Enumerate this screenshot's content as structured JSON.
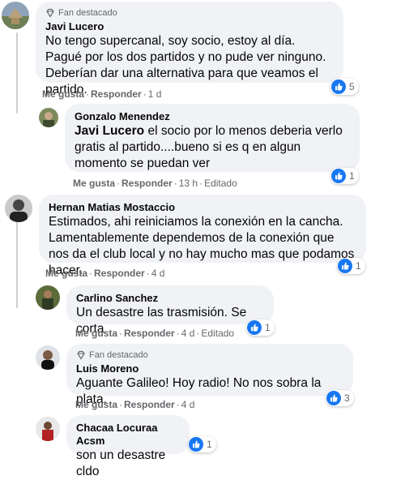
{
  "comments": [
    {
      "badge": "Fan destacado",
      "name": "Javi Lucero",
      "text": "No tengo supercanal, soy socio, estoy al día. Pagué por los dos partidos y no pude ver ninguno. Deberían dar una alternativa para que veamos el partido.",
      "like": "Me gusta",
      "reply": "Responder",
      "time": "1 d",
      "reactions": "5"
    },
    {
      "name": "Gonzalo Menendez",
      "tag": "Javi Lucero",
      "text": " el socio por lo menos deberia verlo gratis al partido....bueno si es q en algun momento se puedan ver",
      "like": "Me gusta",
      "reply": "Responder",
      "time": "13 h",
      "edited": "Editado",
      "reactions": "1"
    },
    {
      "name": "Hernan Matias Mostaccio",
      "text": "Estimados, ahi reiniciamos la conexión en la cancha. Lamentablemente dependemos de la conexión que nos da el club local y no hay mucho mas que podamos hacer.",
      "like": "Me gusta",
      "reply": "Responder",
      "time": "4 d",
      "reactions": "1"
    },
    {
      "name": "Carlino Sanchez",
      "text": "Un desastre las trasmisión. Se corta",
      "like": "Me gusta",
      "reply": "Responder",
      "time": "4 d",
      "edited": "Editado",
      "reactions": "1"
    },
    {
      "badge": "Fan destacado",
      "name": "Luis Moreno",
      "text": "Aguante Galileo! Hoy radio! No nos sobra la plata.",
      "like": "Me gusta",
      "reply": "Responder",
      "time": "4 d",
      "reactions": "3"
    },
    {
      "name": "Chacaa Locuraa Acsm",
      "text": "son un desastre cldo",
      "reactions": "1"
    }
  ],
  "colors": {
    "like_blue": "#1877f2",
    "bubble": "#f0f2f5",
    "meta": "#65676b"
  }
}
